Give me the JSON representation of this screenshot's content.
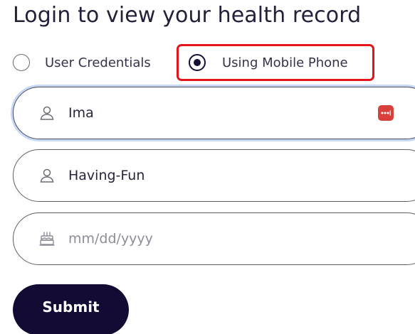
{
  "page": {
    "title": "Login to view your health record"
  },
  "login_method": {
    "options": [
      {
        "label": "User Credentials",
        "selected": false
      },
      {
        "label": "Using Mobile Phone",
        "selected": true
      }
    ],
    "highlight_color": "#e3141b"
  },
  "form": {
    "first_name": {
      "value": "Ima",
      "icon": "user-icon",
      "focused": true
    },
    "last_name": {
      "value": "Having-Fun",
      "icon": "user-icon"
    },
    "birth_date": {
      "placeholder": "mm/dd/yyyy",
      "icon": "birthday-cake-icon"
    },
    "autofill_icon": "password-manager-icon",
    "submit_label": "Submit"
  },
  "colors": {
    "primary": "#130b33",
    "focus_ring": "#c6d8f6",
    "autofill_badge": "#d9403b"
  }
}
